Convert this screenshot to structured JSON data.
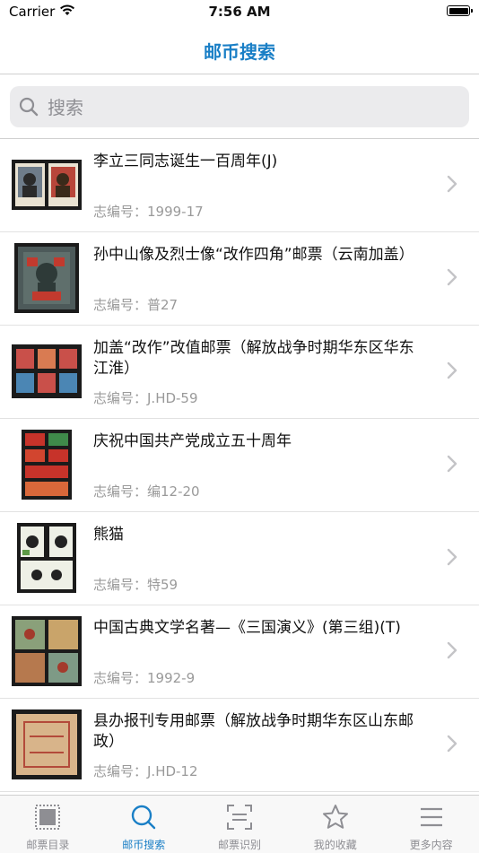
{
  "status_bar": {
    "carrier": "Carrier",
    "time": "7:56 AM"
  },
  "nav": {
    "title": "邮币搜索"
  },
  "search": {
    "placeholder": "搜索"
  },
  "code_prefix": "志编号：",
  "items": [
    {
      "title": "李立三同志诞生一百周年(J)",
      "code": "志编号：1999-17"
    },
    {
      "title": "孙中山像及烈士像“改作四角”邮票（云南加盖）",
      "code": "志编号：普27"
    },
    {
      "title": "加盖“改作”改值邮票（解放战争时期华东区华东江淮）",
      "code": "志编号：J.HD-59"
    },
    {
      "title": "庆祝中国共产党成立五十周年",
      "code": "志编号：编12-20"
    },
    {
      "title": "熊猫",
      "code": "志编号：特59"
    },
    {
      "title": "中国古典文学名著—《三国演义》(第三组)(T)",
      "code": "志编号：1992-9"
    },
    {
      "title": "县办报刊专用邮票（解放战争时期华东区山东邮政）",
      "code": "志编号：J.HD-12"
    }
  ],
  "tabs": [
    {
      "label": "邮票目录",
      "icon": "stamp-catalog-icon",
      "active": false
    },
    {
      "label": "邮币搜索",
      "icon": "search-icon",
      "active": true
    },
    {
      "label": "邮票识别",
      "icon": "scan-icon",
      "active": false
    },
    {
      "label": "我的收藏",
      "icon": "star-icon",
      "active": false
    },
    {
      "label": "更多内容",
      "icon": "menu-icon",
      "active": false
    }
  ],
  "colors": {
    "accent": "#1a7fc6",
    "inactive": "#8e8e93",
    "secondary_text": "#9a9a9a"
  }
}
